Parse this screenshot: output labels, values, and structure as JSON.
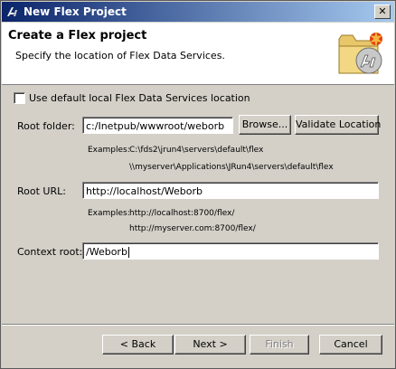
{
  "window": {
    "title": "New Flex Project"
  },
  "banner": {
    "heading": "Create a Flex project",
    "subheading": "Specify the location of Flex Data Services."
  },
  "form": {
    "use_default_label": "Use default local Flex Data Services location",
    "use_default_checked": false,
    "root_folder": {
      "label": "Root folder:",
      "value": "c:/Inetpub/wwwroot/weborb",
      "browse_label": "Browse...",
      "validate_label": "Validate Location",
      "examples_label": "Examples:",
      "example_1": "C:\\fds2\\jrun4\\servers\\default\\flex",
      "example_2": "\\\\myserver\\Applications\\JRun4\\servers\\default\\flex"
    },
    "root_url": {
      "label": "Root URL:",
      "value": "http://localhost/Weborb",
      "examples_label": "Examples:",
      "example_1": "http://localhost:8700/flex/",
      "example_2": "http://myserver.com:8700/flex/"
    },
    "context_root": {
      "label": "Context root:",
      "value": "/Weborb"
    }
  },
  "buttons": {
    "back": "< Back",
    "next": "Next >",
    "finish": "Finish",
    "cancel": "Cancel"
  },
  "colors": {
    "titlebar_start": "#0a246a",
    "titlebar_end": "#a6caf0",
    "dialog_bg": "#d4d0c8"
  },
  "icons": {
    "app": "flex-icon",
    "banner": "folder-flex-icon",
    "close": "close-icon"
  }
}
